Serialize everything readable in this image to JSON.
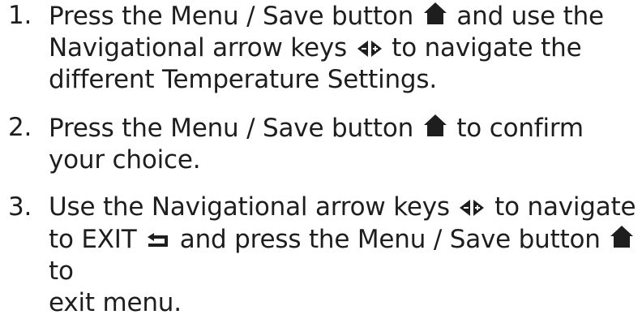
{
  "steps": [
    {
      "number": "1.",
      "parts": {
        "a": "Press the Menu / Save button",
        "b": "and use the",
        "c": "Navigational arrow keys",
        "d": "to navigate the",
        "e": "different Temperature Settings."
      }
    },
    {
      "number": "2.",
      "parts": {
        "a": "Press the Menu / Save button",
        "b": "to confirm",
        "c": "your choice."
      }
    },
    {
      "number": "3.",
      "parts": {
        "a": "Use the Navigational arrow keys",
        "b": "to navigate",
        "c": "to EXIT",
        "d": "and press the Menu / Save button",
        "e": "to",
        "f": "exit menu."
      }
    }
  ],
  "icons": {
    "menu_save": "home-icon",
    "navigation": "left-right-arrows-icon",
    "exit": "exit-arrow-icon"
  },
  "colors": {
    "text": "#1e1e1e",
    "icon": "#1e1e1e"
  }
}
